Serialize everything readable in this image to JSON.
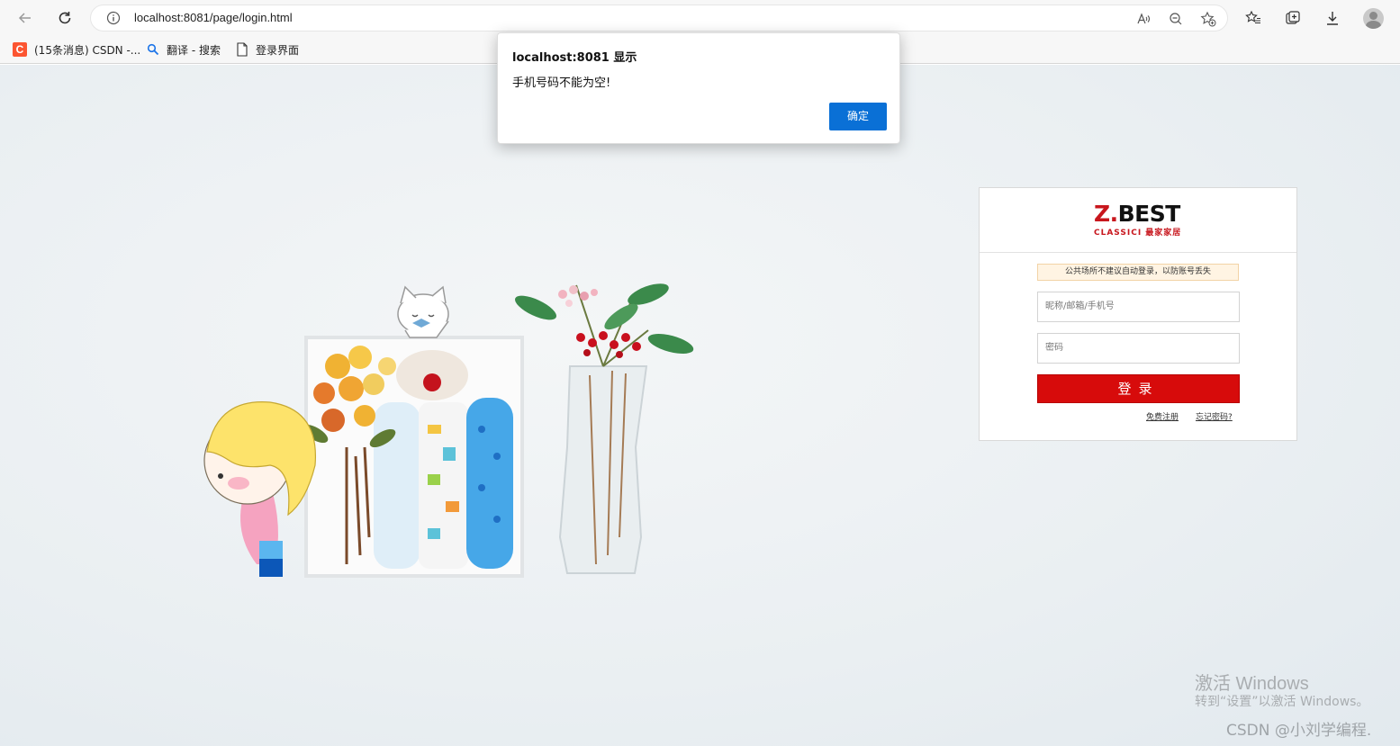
{
  "browser": {
    "url": "localhost:8081/page/login.html",
    "bookmarks": [
      {
        "label": "(15条消息) CSDN -...",
        "icon": "csdn-icon"
      },
      {
        "label": "翻译 - 搜索",
        "icon": "search-icon"
      },
      {
        "label": "登录界面",
        "icon": "page-icon"
      }
    ]
  },
  "dialog": {
    "title": "localhost:8081 显示",
    "message": "手机号码不能为空!",
    "ok_label": "确定"
  },
  "login": {
    "logo_main_prefix": "Z.",
    "logo_main_rest": "BEST",
    "logo_sub": "CLASSICI 最家家居",
    "notice": "公共场所不建议自动登录，以防账号丢失",
    "username_placeholder": "昵称/邮箱/手机号",
    "password_placeholder": "密码",
    "submit_label": "登录",
    "register_link": "免费注册",
    "forgot_link": "忘记密码?"
  },
  "watermark": {
    "activate_title": "激活 Windows",
    "activate_sub": "转到“设置”以激活 Windows。",
    "credit": "CSDN @小刘学编程."
  },
  "colors": {
    "brand_red": "#d70b0b",
    "dialog_button_blue": "#0a70d6",
    "notice_bg": "#fff4e3"
  }
}
